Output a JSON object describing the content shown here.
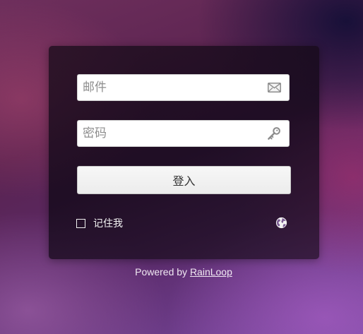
{
  "login": {
    "email": {
      "placeholder": "邮件",
      "value": "",
      "icon": "envelope-icon"
    },
    "password": {
      "placeholder": "密码",
      "value": "",
      "icon": "key-icon"
    },
    "submit_label": "登入",
    "remember_me_label": "记住我",
    "remember_me_checked": false,
    "language_icon": "globe-icon"
  },
  "footer": {
    "powered_by_text": "Powered by ",
    "brand_link": "RainLoop"
  },
  "colors": {
    "panel_background": "#1e0e1e",
    "field_background": "#ffffff",
    "button_background": "#f2f2f2",
    "label_text": "#f4f4f4"
  }
}
